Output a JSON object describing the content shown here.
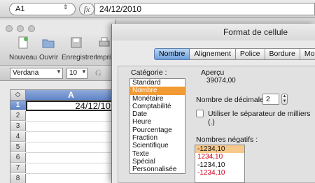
{
  "formula_bar": {
    "cell_ref": "A1",
    "fx_label": "fx",
    "formula_value": "24/12/2010"
  },
  "toolbar": {
    "new_label": "Nouveau",
    "open_label": "Ouvrir",
    "save_label": "Enregistrer",
    "print_label": "Impri"
  },
  "format_bar": {
    "font": "Verdana",
    "size": "10",
    "truncated_glyph": "G"
  },
  "sheet": {
    "select_all_glyph": "◇",
    "column_a": "A",
    "rows": [
      "1",
      "2",
      "3",
      "4",
      "5",
      "6",
      "7",
      "8"
    ],
    "cell_a1": "24/12/10"
  },
  "dialog": {
    "title": "Format de cellule",
    "tabs": [
      "Nombre",
      "Alignement",
      "Police",
      "Bordure",
      "Motifs"
    ],
    "active_tab": "Nombre",
    "category_label": "Catégorie :",
    "categories": [
      "Standard",
      "Nombre",
      "Monétaire",
      "Comptabilité",
      "Date",
      "Heure",
      "Pourcentage",
      "Fraction",
      "Scientifique",
      "Texte",
      "Spécial",
      "Personnalisée"
    ],
    "selected_category": "Nombre",
    "preview_label": "Aperçu",
    "preview_value": "39074,00",
    "decimals_label": "Nombre de décimales :",
    "decimals_value": "2",
    "separator_label": "Utiliser le séparateur de milliers (.)",
    "separator_checked": false,
    "negative_label": "Nombres négatifs :",
    "negative_formats": [
      {
        "text": "-1234,10",
        "color": "#000000"
      },
      {
        "text": "1234,10",
        "color": "#d0021b"
      },
      {
        "text": "-1234,10",
        "color": "#000000"
      },
      {
        "text": "-1234,10",
        "color": "#d0021b"
      }
    ]
  },
  "colors": {
    "accent": "#f29a33",
    "header_blue": "#6e9fdc",
    "negative_red": "#d0021b"
  }
}
